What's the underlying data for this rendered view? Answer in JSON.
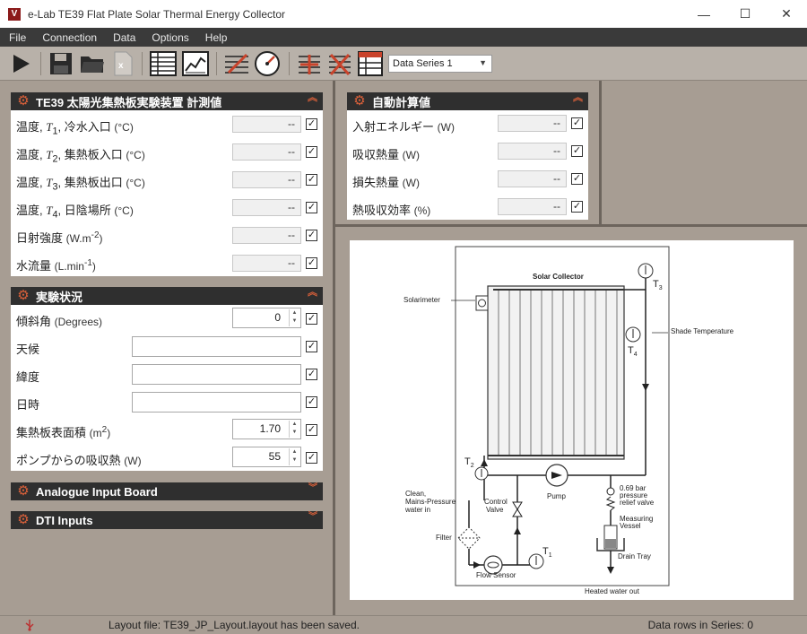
{
  "window": {
    "title": "e-Lab TE39 Flat Plate Solar Thermal Energy Collector",
    "logo_letter": "V",
    "minimize": "—",
    "maximize": "☐",
    "close": "✕"
  },
  "menu": [
    "File",
    "Connection",
    "Data",
    "Options",
    "Help"
  ],
  "toolbar": {
    "series_selected": "Data Series 1"
  },
  "measured_panel": {
    "title": "TE39 太陽光集熱板実験装置  計測値",
    "rows": [
      {
        "label_pre": "温度,",
        "var": "T",
        "sub": "1",
        "label_post": "冷水入口",
        "unit": "(°C)",
        "value": "--"
      },
      {
        "label_pre": "温度,",
        "var": "T",
        "sub": "2",
        "label_post": "集熱板入口",
        "unit": "(°C)",
        "value": "--"
      },
      {
        "label_pre": "温度,",
        "var": "T",
        "sub": "3",
        "label_post": "集熱板出口",
        "unit": "(°C)",
        "value": "--"
      },
      {
        "label_pre": "温度,",
        "var": "T",
        "sub": "4",
        "label_post": "日陰場所",
        "unit": "(°C)",
        "value": "--"
      },
      {
        "label_pre": "日射強度",
        "unit_base": "(W.m",
        "unit_sup": "-2",
        "unit_end": ")",
        "value": "--"
      },
      {
        "label_pre": "水流量",
        "unit_base": "(L.min",
        "unit_sup": "-1",
        "unit_end": ")",
        "value": "--"
      }
    ]
  },
  "calc_panel": {
    "title": "自動計算値",
    "rows": [
      {
        "label": "入射エネルギー",
        "unit": "(W)",
        "value": "--"
      },
      {
        "label": "吸収熱量",
        "unit": "(W)",
        "value": "--"
      },
      {
        "label": "損失熱量",
        "unit": "(W)",
        "value": "--"
      },
      {
        "label": "熱吸収効率",
        "unit": "(%)",
        "value": "--"
      }
    ]
  },
  "conditions_panel": {
    "title": "実験状況",
    "tilt": {
      "label": "傾斜角",
      "unit": "(Degrees)",
      "value": "0"
    },
    "weather": {
      "label": "天候",
      "value": ""
    },
    "latitude": {
      "label": "緯度",
      "value": ""
    },
    "datetime": {
      "label": "日時",
      "value": ""
    },
    "area": {
      "label": "集熱板表面積",
      "unit_base": "(m",
      "unit_sup": "2",
      "unit_end": ")",
      "value": "1.70"
    },
    "pump_heat": {
      "label": "ポンプからの吸収熱",
      "unit": "(W)",
      "value": "55"
    }
  },
  "collapsed_panels": [
    "Analogue Input Board",
    "DTI Inputs"
  ],
  "diagram": {
    "collector": "Solar Collector",
    "solarimeter": "Solarimeter",
    "shade_temp": "Shade Temperature",
    "t1": "T",
    "t1_sub": "1",
    "t2": "T",
    "t2_sub": "2",
    "t3": "T",
    "t3_sub": "3",
    "t4": "T",
    "t4_sub": "4",
    "pump": "Pump",
    "control_valve_1": "Control",
    "control_valve_2": "Valve",
    "clean_1": "Clean,",
    "clean_2": "Mains-Pressure",
    "clean_3": "water in",
    "filter": "Filter",
    "flow_sensor": "Flow Sensor",
    "relief_1": "0.69 bar",
    "relief_2": "pressure",
    "relief_3": "relief valve",
    "vessel_1": "Measuring",
    "vessel_2": "Vessel",
    "drain": "Drain Tray",
    "heated": "Heated water out"
  },
  "status": {
    "message": "Layout file: TE39_JP_Layout.layout has been saved.",
    "rows": "Data rows in Series: 0"
  }
}
